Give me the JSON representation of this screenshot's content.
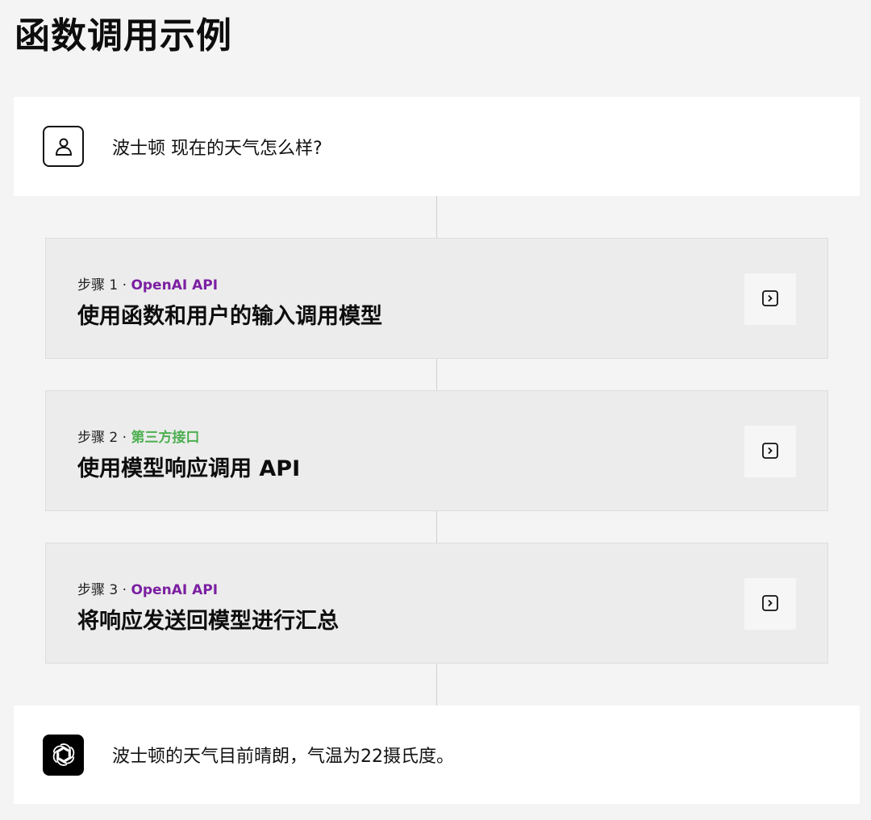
{
  "page": {
    "title": "函数调用示例"
  },
  "user_message": {
    "text": "波士顿 现在的天气怎么样?",
    "avatar_icon": "user-icon"
  },
  "steps": [
    {
      "label": "步骤 1 · ",
      "source": "OpenAI API",
      "source_color": "#7b1fa2",
      "title": "使用函数和用户的输入调用模型",
      "action_icon": "expand-chevron-icon"
    },
    {
      "label": "步骤 2 · ",
      "source": "第三方接口",
      "source_color": "#4caf50",
      "title": "使用模型响应调用 API",
      "action_icon": "expand-chevron-icon"
    },
    {
      "label": "步骤 3 · ",
      "source": "OpenAI API",
      "source_color": "#7b1fa2",
      "title": "将响应发送回模型进行汇总",
      "action_icon": "expand-chevron-icon"
    }
  ],
  "assistant_message": {
    "text": "波士顿的天气目前晴朗，气温为22摄氏度。",
    "avatar_icon": "openai-logo-icon"
  }
}
